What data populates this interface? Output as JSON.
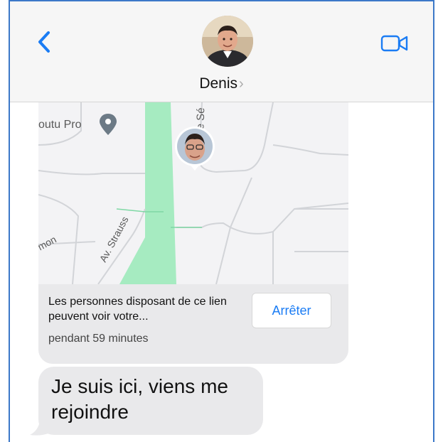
{
  "header": {
    "contact_name": "Denis",
    "contact_chevron": "›",
    "back_icon": "chevron-left-icon",
    "video_icon": "video-camera-icon"
  },
  "map": {
    "labels": [
      {
        "text": "outu Pro"
      },
      {
        "text": "Je Sé"
      },
      {
        "text": "Av. Strauss"
      },
      {
        "text": "'mon"
      }
    ]
  },
  "location_card": {
    "description": "Les personnes disposant de ce lien peuvent voir votre...",
    "duration": "pendant 59 minutes",
    "stop_label": "Arrêter"
  },
  "message": {
    "text": "Je suis ici, viens me rejoindre"
  },
  "colors": {
    "accent": "#1a7cf4",
    "bubble": "#e9e9eb",
    "park": "#9ee6b8",
    "header_bg": "#f6f6f6"
  }
}
